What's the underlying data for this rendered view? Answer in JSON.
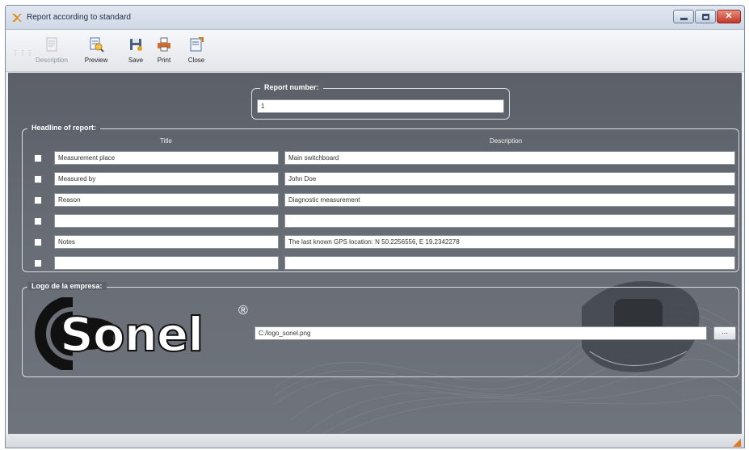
{
  "window": {
    "title": "Report according to standard"
  },
  "toolbar": {
    "description_label": "Description",
    "preview_label": "Preview",
    "save_label": "Save",
    "print_label": "Print",
    "close_label": "Close"
  },
  "report_number": {
    "legend": "Report number:",
    "value": "1"
  },
  "headline": {
    "legend": "Headline of report:",
    "col_title": "Title",
    "col_description": "Description",
    "rows": [
      {
        "checked": false,
        "title": "Measurement place",
        "description": "Main switchboard"
      },
      {
        "checked": false,
        "title": "Measured by",
        "description": "John Doe"
      },
      {
        "checked": false,
        "title": "Reason",
        "description": "Diagnostic measurement"
      },
      {
        "checked": false,
        "title": "",
        "description": ""
      },
      {
        "checked": false,
        "title": "Notes",
        "description": "The last known GPS location: N 50.2256556, E 19.2342278"
      },
      {
        "checked": false,
        "title": "",
        "description": ""
      }
    ]
  },
  "logo": {
    "legend": "Logo de la empresa:",
    "brand_text": "Sonel",
    "registered_mark": "®",
    "path_value": "C:/logo_sonel.png",
    "browse_label": "..."
  },
  "colors": {
    "panel_background": "#646971",
    "group_border": "#d9dce1",
    "close_button": "#c2382a"
  }
}
